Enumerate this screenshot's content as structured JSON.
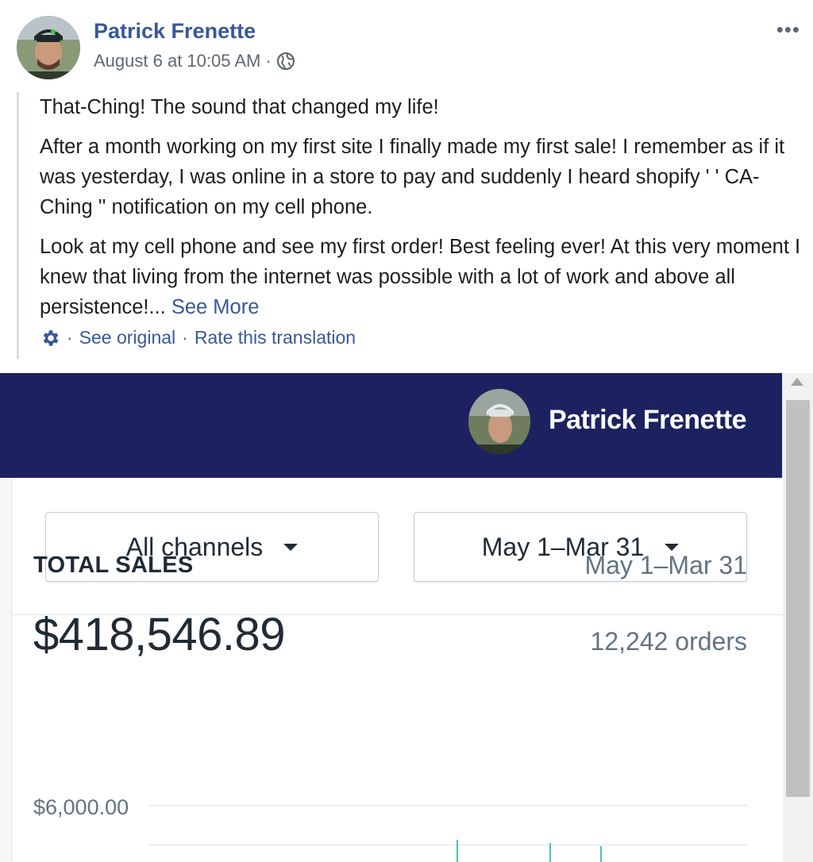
{
  "post": {
    "author": "Patrick Frenette",
    "timestamp": "August 6 at 10:05 AM",
    "meta_separator": "·",
    "more_label": "•••",
    "paragraphs": [
      "That-Ching! The sound that changed my life!",
      "After a month working on my first site I finally made my first sale! I remember as if it was yesterday, I was online in a store to pay and suddenly I heard shopify ' ' CA-Ching '' notification on my cell phone.",
      "Look at my cell phone and see my first order! Best feeling ever! At this very moment I knew that living from the internet was possible with a lot of work and above all persistence!..."
    ],
    "see_more": "See More",
    "translation": {
      "separator": "·",
      "see_original": "See original",
      "rate": "Rate this translation"
    }
  },
  "screenshot": {
    "topbar_color": "#1c2260",
    "user_name": "Patrick Frenette",
    "filters": {
      "channel": "All channels",
      "date_range": "May 1–Mar 31"
    },
    "total_sales": {
      "label": "TOTAL SALES",
      "range": "May 1–Mar 31",
      "amount": "$418,546.89",
      "orders": "12,242 orders"
    },
    "chart_axis_label": "$6,000.00"
  },
  "icons": {
    "avatar": "avatar",
    "globe": "globe-icon",
    "gear": "gear-icon",
    "caret": "chevron-down-icon",
    "more": "more-icon"
  }
}
